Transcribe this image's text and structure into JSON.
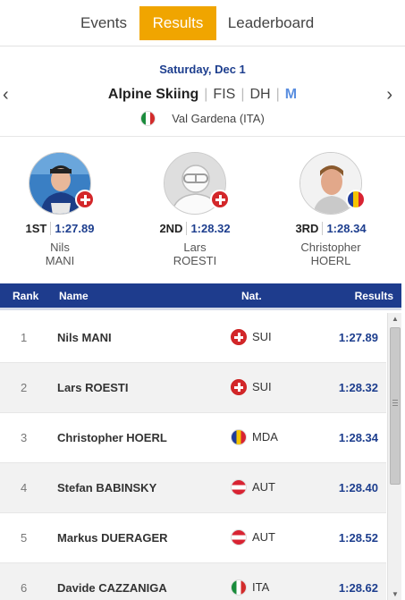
{
  "tabs": [
    {
      "label": "Events",
      "active": false
    },
    {
      "label": "Results",
      "active": true
    },
    {
      "label": "Leaderboard",
      "active": false
    }
  ],
  "event": {
    "date": "Saturday, Dec 1",
    "sport": "Alpine Skiing",
    "federation": "FIS",
    "discipline": "DH",
    "gender": "M",
    "venue": "Val Gardena (ITA)",
    "venue_flag": "ita-flag-icon",
    "prev_arrow": "‹",
    "next_arrow": "›"
  },
  "podium": [
    {
      "place": "1ST",
      "time": "1:27.89",
      "first": "Nils",
      "last": "MANI",
      "flag": "sui",
      "photo": "athlete-photo"
    },
    {
      "place": "2ND",
      "time": "1:28.32",
      "first": "Lars",
      "last": "ROESTI",
      "flag": "sui",
      "photo": "placeholder-avatar-icon"
    },
    {
      "place": "3RD",
      "time": "1:28.34",
      "first": "Christopher",
      "last": "HOERL",
      "flag": "mda",
      "photo": "athlete-photo"
    }
  ],
  "table": {
    "headers": {
      "rank": "Rank",
      "name": "Name",
      "nat": "Nat.",
      "results": "Results"
    },
    "rows": [
      {
        "rank": "1",
        "name": "Nils MANI",
        "nat": "SUI",
        "flag": "sui",
        "result": "1:27.89"
      },
      {
        "rank": "2",
        "name": "Lars ROESTI",
        "nat": "SUI",
        "flag": "sui",
        "result": "1:28.32"
      },
      {
        "rank": "3",
        "name": "Christopher HOERL",
        "nat": "MDA",
        "flag": "mda",
        "result": "1:28.34"
      },
      {
        "rank": "4",
        "name": "Stefan BABINSKY",
        "nat": "AUT",
        "flag": "aut",
        "result": "1:28.40"
      },
      {
        "rank": "5",
        "name": "Markus DUERAGER",
        "nat": "AUT",
        "flag": "aut",
        "result": "1:28.52"
      },
      {
        "rank": "6",
        "name": "Davide CAZZANIGA",
        "nat": "ITA",
        "flag": "ita",
        "result": "1:28.62"
      }
    ]
  },
  "colors": {
    "accent": "#f0a500",
    "header_blue": "#1e3c8d",
    "time_blue": "#1d3e8e"
  }
}
